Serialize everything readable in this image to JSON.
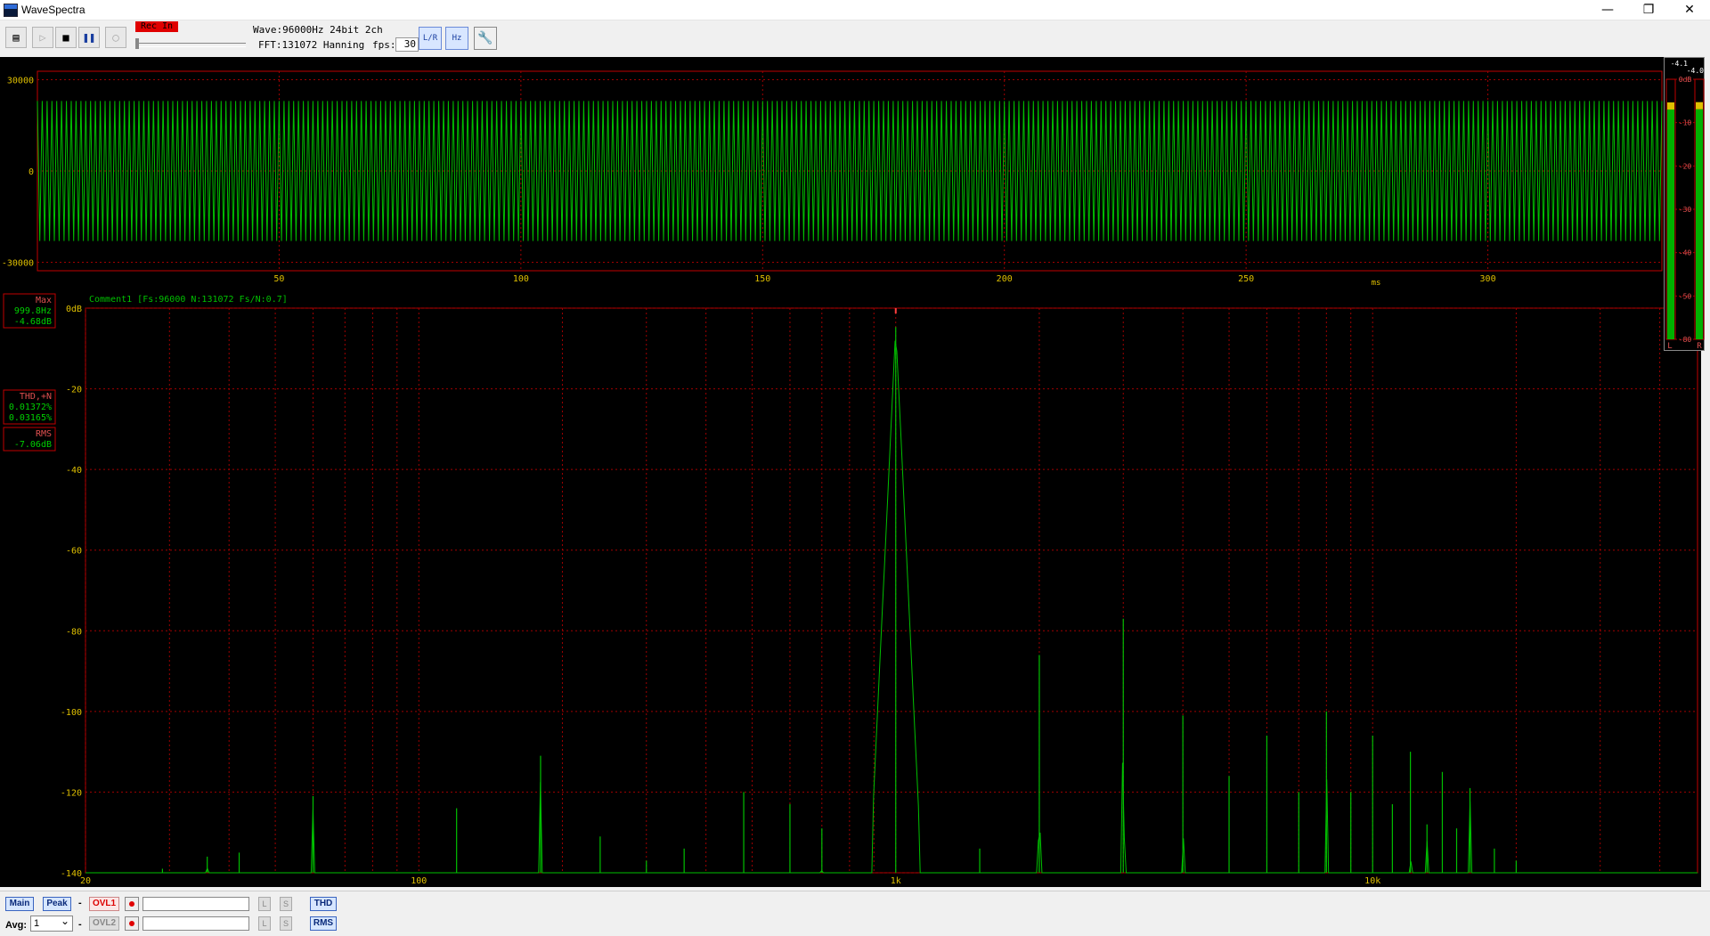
{
  "window": {
    "title": "WaveSpectra",
    "minimize": "—",
    "restore": "❐",
    "close": "✕"
  },
  "toolbar": {
    "rec_label": "Rec In",
    "wave_info": "Wave:96000Hz 24bit 2ch",
    "fft_info": "FFT:131072 Hanning",
    "fps_label": "fps:",
    "fps_value": "30",
    "buttons": [
      "open-file-icon",
      "play-icon",
      "stop-icon",
      "pause-icon",
      "record-icon"
    ],
    "icon_buttons": [
      "LR",
      "Hz/dB",
      "settings"
    ]
  },
  "wave": {
    "y_ticks": [
      "30000",
      "0",
      "-30000"
    ],
    "y_values": [
      30000,
      0,
      -30000
    ],
    "x_ticks": [
      "50",
      "100",
      "150",
      "200",
      "250",
      "300"
    ],
    "x_values": [
      50,
      100,
      150,
      200,
      250,
      300
    ],
    "x_unit": "ms",
    "xlim": [
      0,
      336
    ],
    "ylim": [
      -32768,
      32767
    ],
    "amplitude": 23000,
    "color": "#00c000"
  },
  "spectrum": {
    "comment": "Comment1  [Fs:96000 N:131072 Fs/N:0.7]",
    "x_ticks": [
      "20",
      "100",
      "1k",
      "10k"
    ],
    "x_values": [
      20,
      100,
      1000,
      10000
    ],
    "y_ticks": [
      "0dB",
      "-20",
      "-40",
      "-60",
      "-80",
      "-100",
      "-120",
      "-140"
    ],
    "y_values": [
      0,
      -20,
      -40,
      -60,
      -80,
      -100,
      -120,
      -140
    ],
    "xlim": [
      20,
      48000
    ],
    "ylim": [
      -140,
      0
    ],
    "max_box": {
      "title": "Max",
      "freq": "999.8Hz",
      "level": "-4.68dB"
    },
    "thd_box": {
      "title": "THD,+N",
      "v1": "0.01372%",
      "v2": "0.03165%"
    },
    "rms_box": {
      "title": "RMS",
      "level": "-7.06dB"
    },
    "color": "#00c000"
  },
  "chart_data": {
    "type": "line",
    "x_scale": "log",
    "xlim": [
      20,
      48000
    ],
    "ylim": [
      -140,
      0
    ],
    "peaks": [
      {
        "f": 29,
        "db": -139
      },
      {
        "f": 36,
        "db": -136
      },
      {
        "f": 42,
        "db": -135
      },
      {
        "f": 60,
        "db": -121
      },
      {
        "f": 120,
        "db": -124
      },
      {
        "f": 180,
        "db": -111
      },
      {
        "f": 240,
        "db": -131
      },
      {
        "f": 300,
        "db": -137
      },
      {
        "f": 360,
        "db": -134
      },
      {
        "f": 480,
        "db": -120
      },
      {
        "f": 600,
        "db": -123
      },
      {
        "f": 700,
        "db": -129
      },
      {
        "f": 1000,
        "db": -4.7
      },
      {
        "f": 1500,
        "db": -134
      },
      {
        "f": 2000,
        "db": -86
      },
      {
        "f": 3000,
        "db": -77
      },
      {
        "f": 4000,
        "db": -101
      },
      {
        "f": 5000,
        "db": -116
      },
      {
        "f": 6000,
        "db": -106
      },
      {
        "f": 7000,
        "db": -120
      },
      {
        "f": 8000,
        "db": -100
      },
      {
        "f": 9000,
        "db": -120
      },
      {
        "f": 10000,
        "db": -106
      },
      {
        "f": 11000,
        "db": -123
      },
      {
        "f": 12000,
        "db": -110
      },
      {
        "f": 13000,
        "db": -128
      },
      {
        "f": 14000,
        "db": -115
      },
      {
        "f": 15000,
        "db": -129
      },
      {
        "f": 16000,
        "db": -119
      },
      {
        "f": 18000,
        "db": -134
      },
      {
        "f": 20000,
        "db": -137
      }
    ]
  },
  "vu": {
    "scale": [
      "0dB",
      "-10",
      "-20",
      "-30",
      "-40",
      "-50",
      "-80"
    ],
    "left_peak": "-4.1",
    "right_peak": "-4.0",
    "left_level": -4.1,
    "right_level": -4.0,
    "channels": [
      "L",
      "R"
    ]
  },
  "bottom": {
    "main_btn": "Main",
    "peak_btn": "Peak",
    "ovl1": "OVL1",
    "ovl2": "OVL2",
    "thd_btn": "THD",
    "rms_btn": "RMS",
    "avg_label": "Avg:",
    "avg_value": "1",
    "dash": "-",
    "l": "L",
    "s": "S"
  }
}
